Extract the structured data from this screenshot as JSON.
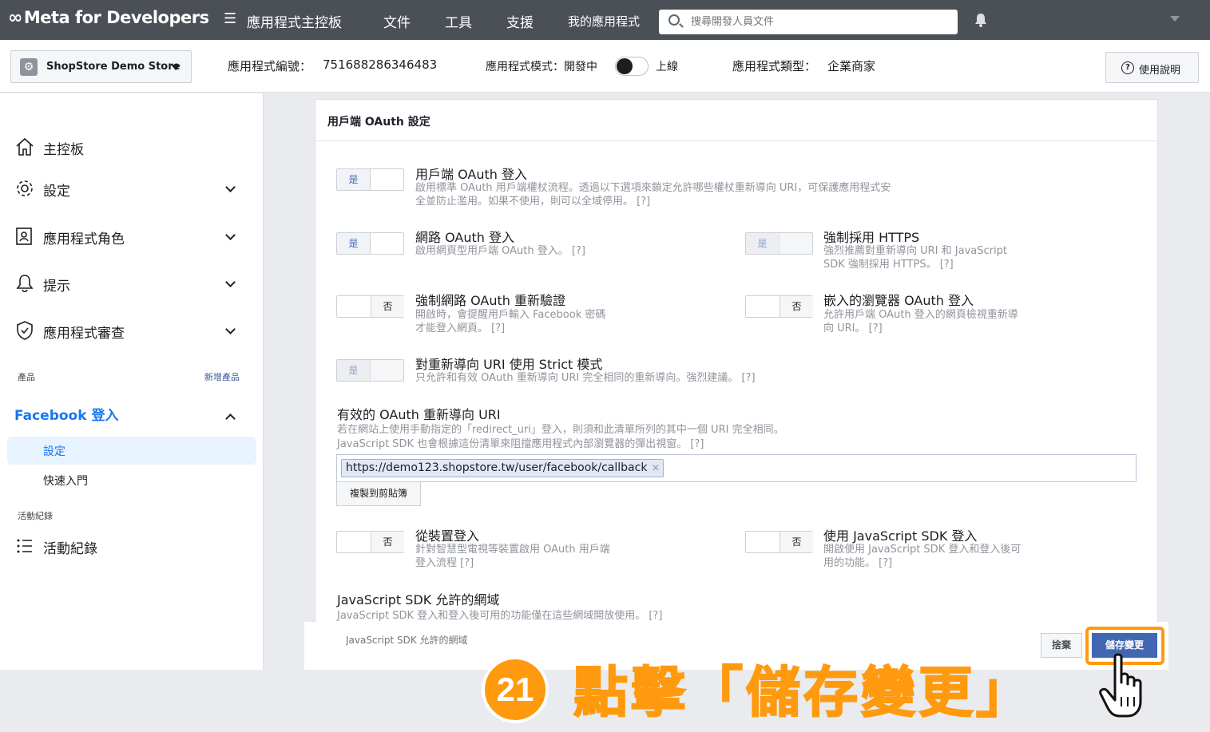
{
  "topbar": {
    "logo": "Meta for Developers",
    "nav": [
      "應用程式主控板",
      "文件",
      "工具",
      "支援",
      "我的應用程式"
    ],
    "search_placeholder": "搜尋開發人員文件"
  },
  "subbar": {
    "app_name": "ShopStore Demo Store",
    "app_id_label": "應用程式編號：",
    "app_id": "751688286346483",
    "mode_label": "應用程式模式：開發中",
    "mode_live": "上線",
    "type_label": "應用程式類型：",
    "type_value": "企業商家",
    "help": "使用說明"
  },
  "sidebar": {
    "items": [
      {
        "label": "主控板",
        "icon": "home-icon"
      },
      {
        "label": "設定",
        "icon": "gear-icon"
      },
      {
        "label": "應用程式角色",
        "icon": "roles-icon"
      },
      {
        "label": "提示",
        "icon": "bell-icon"
      },
      {
        "label": "應用程式審查",
        "icon": "shield-icon"
      }
    ],
    "products_label": "產品",
    "add_product": "新增產品",
    "fb_login": "Facebook 登入",
    "sub_settings": "設定",
    "sub_quickstart": "快速入門",
    "activity_section": "活動紀錄",
    "activity_item": "活動紀錄"
  },
  "panel": {
    "title": "用戶端 OAuth 設定",
    "options": [
      {
        "title": "用戶端 OAuth 登入",
        "desc1": "啟用標準 OAuth 用戶端權杖流程。透過以下選項來鎖定允許哪些權杖重新導向 URI，可保護應用程式安",
        "desc2": "全並防止濫用。如果不使用，則可以全域停用。 [?]",
        "state": "是"
      },
      {
        "title": "網路 OAuth 登入",
        "desc1": "啟用網頁型用戶端 OAuth 登入。 [?]",
        "desc2": "",
        "state": "是"
      },
      {
        "title": "強制採用 HTTPS",
        "desc1": "強烈推薦對重新導向 URI 和 JavaScript",
        "desc2": "SDK 強制採用 HTTPS。 [?]",
        "state": "是"
      },
      {
        "title": "強制網路 OAuth 重新驗證",
        "desc1": "開啟時，會提醒用戶輸入 Facebook 密碼",
        "desc2": "才能登入網頁。 [?]",
        "state": "否"
      },
      {
        "title": "嵌入的瀏覽器 OAuth 登入",
        "desc1": "允許用戶端 OAuth 登入的網頁檢視重新導",
        "desc2": "向 URI。 [?]",
        "state": "否"
      },
      {
        "title": "對重新導向 URI 使用 Strict 模式",
        "desc1": "只允許和有效 OAuth 重新導向 URI 完全相同的重新導向。強烈建議。 [?]",
        "desc2": "",
        "state": "是"
      },
      {
        "title": "從裝置登入",
        "desc1": "針對智慧型電視等裝置啟用 OAuth 用戶端",
        "desc2": "登入流程 [?]",
        "state": "否"
      },
      {
        "title": "使用 JavaScript SDK 登入",
        "desc1": "開啟使用 JavaScript SDK 登入和登入後可",
        "desc2": "用的功能。 [?]",
        "state": "否"
      }
    ],
    "redirect_title": "有效的 OAuth 重新導向 URI",
    "redirect_desc1": "若在網站上使用手動指定的「redirect_uri」登入，則須和此清單所列的其中一個 URI 完全相同。",
    "redirect_desc2": "JavaScript SDK 也會根據這份清單來阻擋應用程式內部瀏覽器的彈出視窗。 [?]",
    "redirect_uri": "https://demo123.shopstore.tw/user/facebook/callback",
    "copy_btn": "複製到剪貼簿",
    "domains_title": "JavaScript SDK 允許的網域",
    "domains_desc": "JavaScript SDK 登入和登入後可用的功能僅在這些網域開放使用。 [?]",
    "domains_placeholder": "JavaScript SDK 允許的網域",
    "discard": "捨棄",
    "save": "儲存變更"
  },
  "annotation": {
    "step": "21",
    "text": "點擊「儲存變更」",
    "color": "#ff9a0e"
  }
}
